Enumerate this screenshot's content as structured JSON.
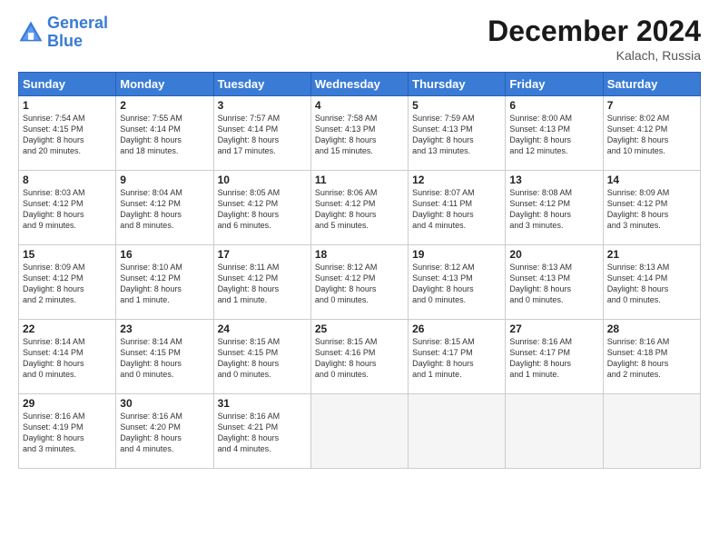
{
  "header": {
    "logo_line1": "General",
    "logo_line2": "Blue",
    "month_title": "December 2024",
    "location": "Kalach, Russia"
  },
  "weekdays": [
    "Sunday",
    "Monday",
    "Tuesday",
    "Wednesday",
    "Thursday",
    "Friday",
    "Saturday"
  ],
  "weeks": [
    [
      {
        "day": "1",
        "lines": [
          "Sunrise: 7:54 AM",
          "Sunset: 4:15 PM",
          "Daylight: 8 hours",
          "and 20 minutes."
        ]
      },
      {
        "day": "2",
        "lines": [
          "Sunrise: 7:55 AM",
          "Sunset: 4:14 PM",
          "Daylight: 8 hours",
          "and 18 minutes."
        ]
      },
      {
        "day": "3",
        "lines": [
          "Sunrise: 7:57 AM",
          "Sunset: 4:14 PM",
          "Daylight: 8 hours",
          "and 17 minutes."
        ]
      },
      {
        "day": "4",
        "lines": [
          "Sunrise: 7:58 AM",
          "Sunset: 4:13 PM",
          "Daylight: 8 hours",
          "and 15 minutes."
        ]
      },
      {
        "day": "5",
        "lines": [
          "Sunrise: 7:59 AM",
          "Sunset: 4:13 PM",
          "Daylight: 8 hours",
          "and 13 minutes."
        ]
      },
      {
        "day": "6",
        "lines": [
          "Sunrise: 8:00 AM",
          "Sunset: 4:13 PM",
          "Daylight: 8 hours",
          "and 12 minutes."
        ]
      },
      {
        "day": "7",
        "lines": [
          "Sunrise: 8:02 AM",
          "Sunset: 4:12 PM",
          "Daylight: 8 hours",
          "and 10 minutes."
        ]
      }
    ],
    [
      {
        "day": "8",
        "lines": [
          "Sunrise: 8:03 AM",
          "Sunset: 4:12 PM",
          "Daylight: 8 hours",
          "and 9 minutes."
        ]
      },
      {
        "day": "9",
        "lines": [
          "Sunrise: 8:04 AM",
          "Sunset: 4:12 PM",
          "Daylight: 8 hours",
          "and 8 minutes."
        ]
      },
      {
        "day": "10",
        "lines": [
          "Sunrise: 8:05 AM",
          "Sunset: 4:12 PM",
          "Daylight: 8 hours",
          "and 6 minutes."
        ]
      },
      {
        "day": "11",
        "lines": [
          "Sunrise: 8:06 AM",
          "Sunset: 4:12 PM",
          "Daylight: 8 hours",
          "and 5 minutes."
        ]
      },
      {
        "day": "12",
        "lines": [
          "Sunrise: 8:07 AM",
          "Sunset: 4:11 PM",
          "Daylight: 8 hours",
          "and 4 minutes."
        ]
      },
      {
        "day": "13",
        "lines": [
          "Sunrise: 8:08 AM",
          "Sunset: 4:12 PM",
          "Daylight: 8 hours",
          "and 3 minutes."
        ]
      },
      {
        "day": "14",
        "lines": [
          "Sunrise: 8:09 AM",
          "Sunset: 4:12 PM",
          "Daylight: 8 hours",
          "and 3 minutes."
        ]
      }
    ],
    [
      {
        "day": "15",
        "lines": [
          "Sunrise: 8:09 AM",
          "Sunset: 4:12 PM",
          "Daylight: 8 hours",
          "and 2 minutes."
        ]
      },
      {
        "day": "16",
        "lines": [
          "Sunrise: 8:10 AM",
          "Sunset: 4:12 PM",
          "Daylight: 8 hours",
          "and 1 minute."
        ]
      },
      {
        "day": "17",
        "lines": [
          "Sunrise: 8:11 AM",
          "Sunset: 4:12 PM",
          "Daylight: 8 hours",
          "and 1 minute."
        ]
      },
      {
        "day": "18",
        "lines": [
          "Sunrise: 8:12 AM",
          "Sunset: 4:12 PM",
          "Daylight: 8 hours",
          "and 0 minutes."
        ]
      },
      {
        "day": "19",
        "lines": [
          "Sunrise: 8:12 AM",
          "Sunset: 4:13 PM",
          "Daylight: 8 hours",
          "and 0 minutes."
        ]
      },
      {
        "day": "20",
        "lines": [
          "Sunrise: 8:13 AM",
          "Sunset: 4:13 PM",
          "Daylight: 8 hours",
          "and 0 minutes."
        ]
      },
      {
        "day": "21",
        "lines": [
          "Sunrise: 8:13 AM",
          "Sunset: 4:14 PM",
          "Daylight: 8 hours",
          "and 0 minutes."
        ]
      }
    ],
    [
      {
        "day": "22",
        "lines": [
          "Sunrise: 8:14 AM",
          "Sunset: 4:14 PM",
          "Daylight: 8 hours",
          "and 0 minutes."
        ]
      },
      {
        "day": "23",
        "lines": [
          "Sunrise: 8:14 AM",
          "Sunset: 4:15 PM",
          "Daylight: 8 hours",
          "and 0 minutes."
        ]
      },
      {
        "day": "24",
        "lines": [
          "Sunrise: 8:15 AM",
          "Sunset: 4:15 PM",
          "Daylight: 8 hours",
          "and 0 minutes."
        ]
      },
      {
        "day": "25",
        "lines": [
          "Sunrise: 8:15 AM",
          "Sunset: 4:16 PM",
          "Daylight: 8 hours",
          "and 0 minutes."
        ]
      },
      {
        "day": "26",
        "lines": [
          "Sunrise: 8:15 AM",
          "Sunset: 4:17 PM",
          "Daylight: 8 hours",
          "and 1 minute."
        ]
      },
      {
        "day": "27",
        "lines": [
          "Sunrise: 8:16 AM",
          "Sunset: 4:17 PM",
          "Daylight: 8 hours",
          "and 1 minute."
        ]
      },
      {
        "day": "28",
        "lines": [
          "Sunrise: 8:16 AM",
          "Sunset: 4:18 PM",
          "Daylight: 8 hours",
          "and 2 minutes."
        ]
      }
    ],
    [
      {
        "day": "29",
        "lines": [
          "Sunrise: 8:16 AM",
          "Sunset: 4:19 PM",
          "Daylight: 8 hours",
          "and 3 minutes."
        ]
      },
      {
        "day": "30",
        "lines": [
          "Sunrise: 8:16 AM",
          "Sunset: 4:20 PM",
          "Daylight: 8 hours",
          "and 4 minutes."
        ]
      },
      {
        "day": "31",
        "lines": [
          "Sunrise: 8:16 AM",
          "Sunset: 4:21 PM",
          "Daylight: 8 hours",
          "and 4 minutes."
        ]
      },
      null,
      null,
      null,
      null
    ]
  ]
}
